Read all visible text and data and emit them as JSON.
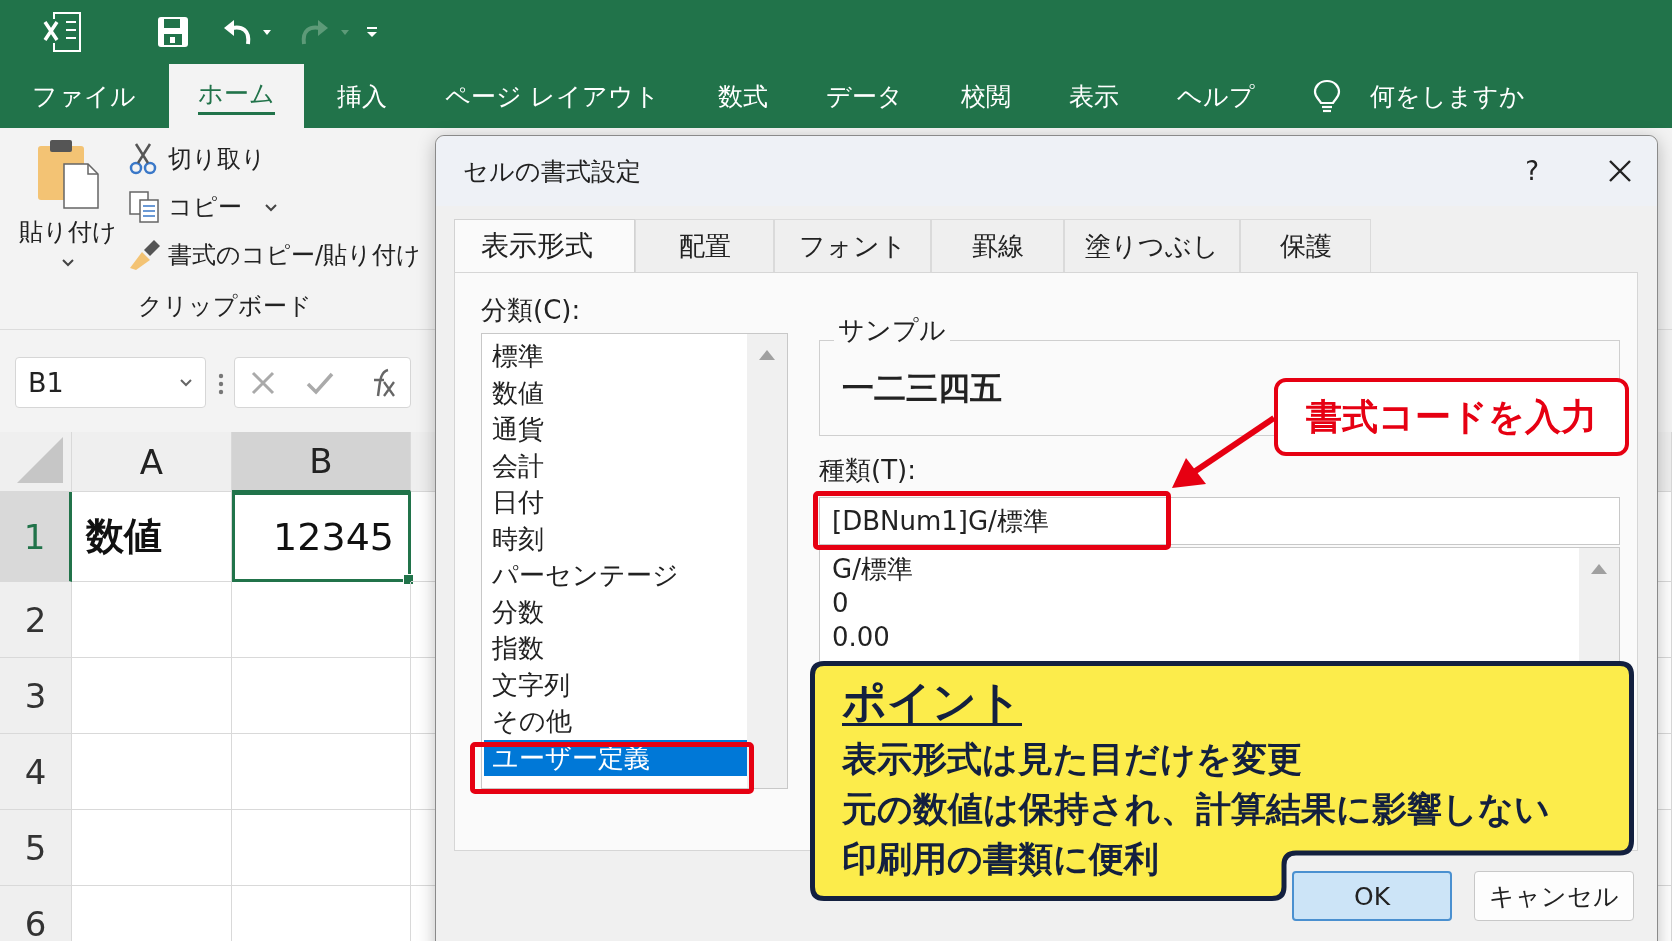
{
  "ribbon_tabs": [
    {
      "label": "ファイル",
      "selected": false
    },
    {
      "label": "ホーム",
      "selected": true
    },
    {
      "label": "挿入",
      "selected": false
    },
    {
      "label": "ページ レイアウト",
      "selected": false
    },
    {
      "label": "数式",
      "selected": false
    },
    {
      "label": "データ",
      "selected": false
    },
    {
      "label": "校閲",
      "selected": false
    },
    {
      "label": "表示",
      "selected": false
    },
    {
      "label": "ヘルプ",
      "selected": false
    }
  ],
  "tell_me": "何をしますか",
  "clipboard": {
    "paste": "貼り付け",
    "cut": "切り取り",
    "copy": "コピー",
    "format_painter": "書式のコピー/貼り付け",
    "group_label": "クリップボード"
  },
  "name_box": "B1",
  "sheet": {
    "columns": [
      {
        "label": "A",
        "selected": false
      },
      {
        "label": "B",
        "selected": true
      }
    ],
    "rows": [
      {
        "label": "1",
        "selected": true,
        "cells": [
          {
            "text": "数値",
            "bold": true,
            "kind": "text",
            "active": false
          },
          {
            "text": "12345",
            "bold": false,
            "kind": "number",
            "active": true
          }
        ]
      },
      {
        "label": "2",
        "selected": false
      },
      {
        "label": "3",
        "selected": false
      },
      {
        "label": "4",
        "selected": false
      },
      {
        "label": "5",
        "selected": false
      },
      {
        "label": "6",
        "selected": false
      }
    ]
  },
  "dialog": {
    "title": "セルの書式設定",
    "help": "?",
    "tabs": [
      {
        "label": "表示形式",
        "selected": true
      },
      {
        "label": "配置",
        "selected": false
      },
      {
        "label": "フォント",
        "selected": false
      },
      {
        "label": "罫線",
        "selected": false
      },
      {
        "label": "塗りつぶし",
        "selected": false
      },
      {
        "label": "保護",
        "selected": false
      }
    ],
    "category_label": "分類(C):",
    "categories": [
      {
        "label": "標準",
        "selected": false,
        "highlighted": false
      },
      {
        "label": "数値",
        "selected": false,
        "highlighted": false
      },
      {
        "label": "通貨",
        "selected": false,
        "highlighted": false
      },
      {
        "label": "会計",
        "selected": false,
        "highlighted": false
      },
      {
        "label": "日付",
        "selected": false,
        "highlighted": false
      },
      {
        "label": "時刻",
        "selected": false,
        "highlighted": false
      },
      {
        "label": "パーセンテージ",
        "selected": false,
        "highlighted": false
      },
      {
        "label": "分数",
        "selected": false,
        "highlighted": false
      },
      {
        "label": "指数",
        "selected": false,
        "highlighted": false
      },
      {
        "label": "文字列",
        "selected": false,
        "highlighted": false
      },
      {
        "label": "その他",
        "selected": false,
        "highlighted": false
      },
      {
        "label": "ユーザー定義",
        "selected": true,
        "highlighted": true
      }
    ],
    "sample_label": "サンプル",
    "sample_value": "一二三四五",
    "type_field": {
      "label": "種類(T):",
      "value": "[DBNum1]G/標準",
      "highlighted": true
    },
    "formats": [
      "G/標準",
      "0",
      "0.00"
    ],
    "buttons": [
      {
        "label": "OK",
        "kind": "primary"
      },
      {
        "label": "キャンセル",
        "kind": "secondary"
      }
    ]
  },
  "callouts": [
    {
      "kind": "label",
      "text": "書式コードを入力"
    },
    {
      "kind": "note",
      "title": "ポイント",
      "lines": [
        "表示形式は見た目だけを変更",
        "元の数値は保持され、計算結果に影響しない",
        "印刷用の書類に便利"
      ]
    }
  ]
}
